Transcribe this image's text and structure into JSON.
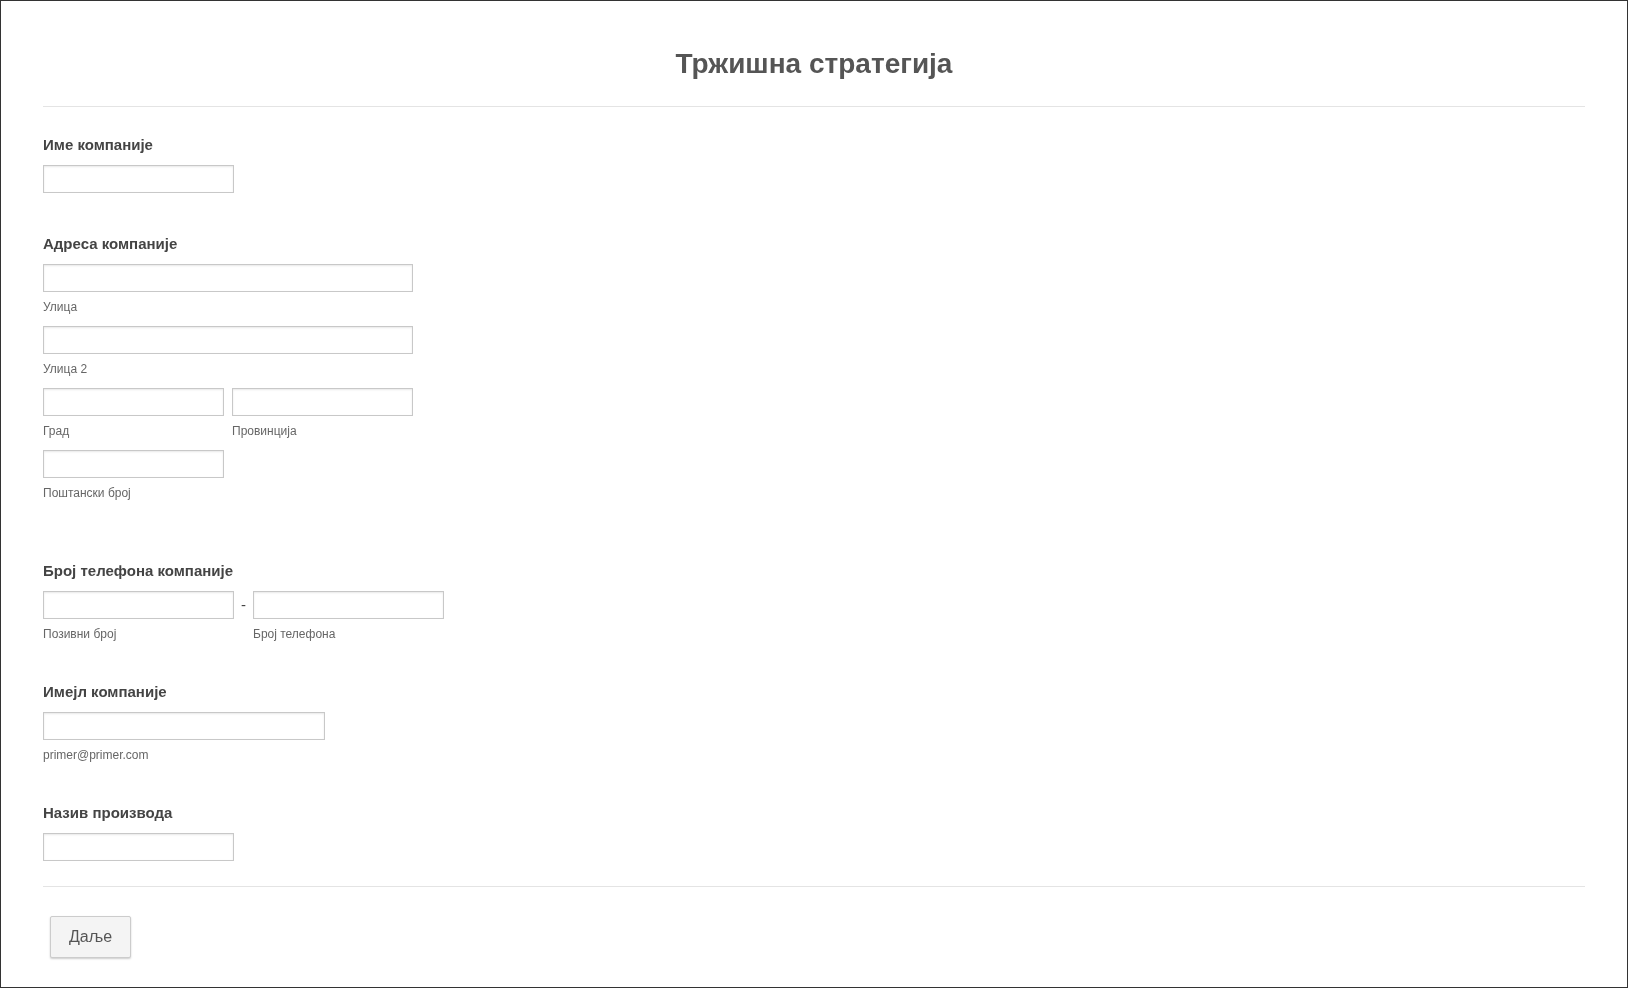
{
  "title": "Тржишна стратегија",
  "sections": [
    {
      "kind": "text",
      "label": "Име компаније",
      "rows": [
        [
          {
            "kind": "input"
          }
        ]
      ]
    },
    {
      "kind": "address",
      "label": "Адреса компаније",
      "rows": [
        [
          {
            "kind": "input",
            "sublabel": "Улица"
          }
        ],
        [
          {
            "kind": "input",
            "sublabel": "Улица 2"
          }
        ],
        [
          {
            "kind": "input",
            "sublabel": "Град"
          },
          {
            "kind": "input",
            "sublabel": "Провинција"
          }
        ],
        [
          {
            "kind": "input",
            "sublabel": "Поштански број"
          }
        ]
      ]
    },
    {
      "kind": "phone",
      "label": "Број телефона компаније",
      "rows": [
        [
          {
            "kind": "input",
            "sublabel": "Позивни број"
          },
          {
            "kind": "separator",
            "text": "-"
          },
          {
            "kind": "input",
            "sublabel": "Број телефона"
          }
        ]
      ]
    },
    {
      "kind": "email",
      "label": "Имејл компаније",
      "rows": [
        [
          {
            "kind": "input",
            "sublabel": "primer@primer.com"
          }
        ]
      ]
    },
    {
      "kind": "text",
      "label": "Назив производа",
      "rows": [
        [
          {
            "kind": "input"
          }
        ]
      ]
    }
  ],
  "button": "Даље"
}
